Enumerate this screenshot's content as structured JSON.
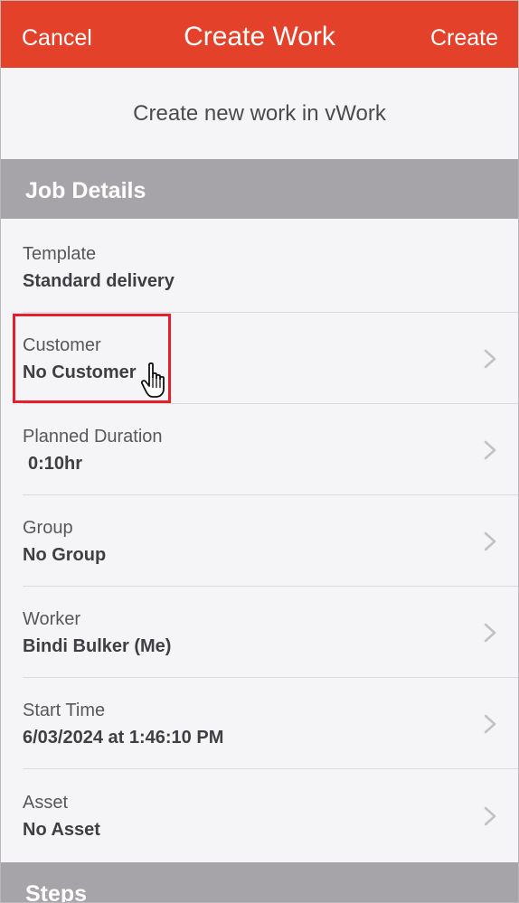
{
  "navbar": {
    "cancel_label": "Cancel",
    "title": "Create Work",
    "create_label": "Create",
    "color": "#e4412b"
  },
  "subtitle": "Create new work in vWork",
  "sections": {
    "job_details": "Job Details",
    "steps": "Steps"
  },
  "rows": {
    "template": {
      "label": "Template",
      "value": "Standard delivery"
    },
    "customer": {
      "label": "Customer",
      "value": "No Customer"
    },
    "planned_duration": {
      "label": "Planned Duration",
      "value": "0:10hr"
    },
    "group": {
      "label": "Group",
      "value": "No Group"
    },
    "worker": {
      "label": "Worker",
      "value": "Bindi Bulker (Me)"
    },
    "start_time": {
      "label": "Start Time",
      "value": "6/03/2024 at 1:46:10 PM"
    },
    "asset": {
      "label": "Asset",
      "value": "No Asset"
    }
  },
  "icons": {
    "chevron": "chevron-right-icon",
    "cursor": "hand-pointer-cursor-icon"
  },
  "highlight_color": "#e51f2b"
}
